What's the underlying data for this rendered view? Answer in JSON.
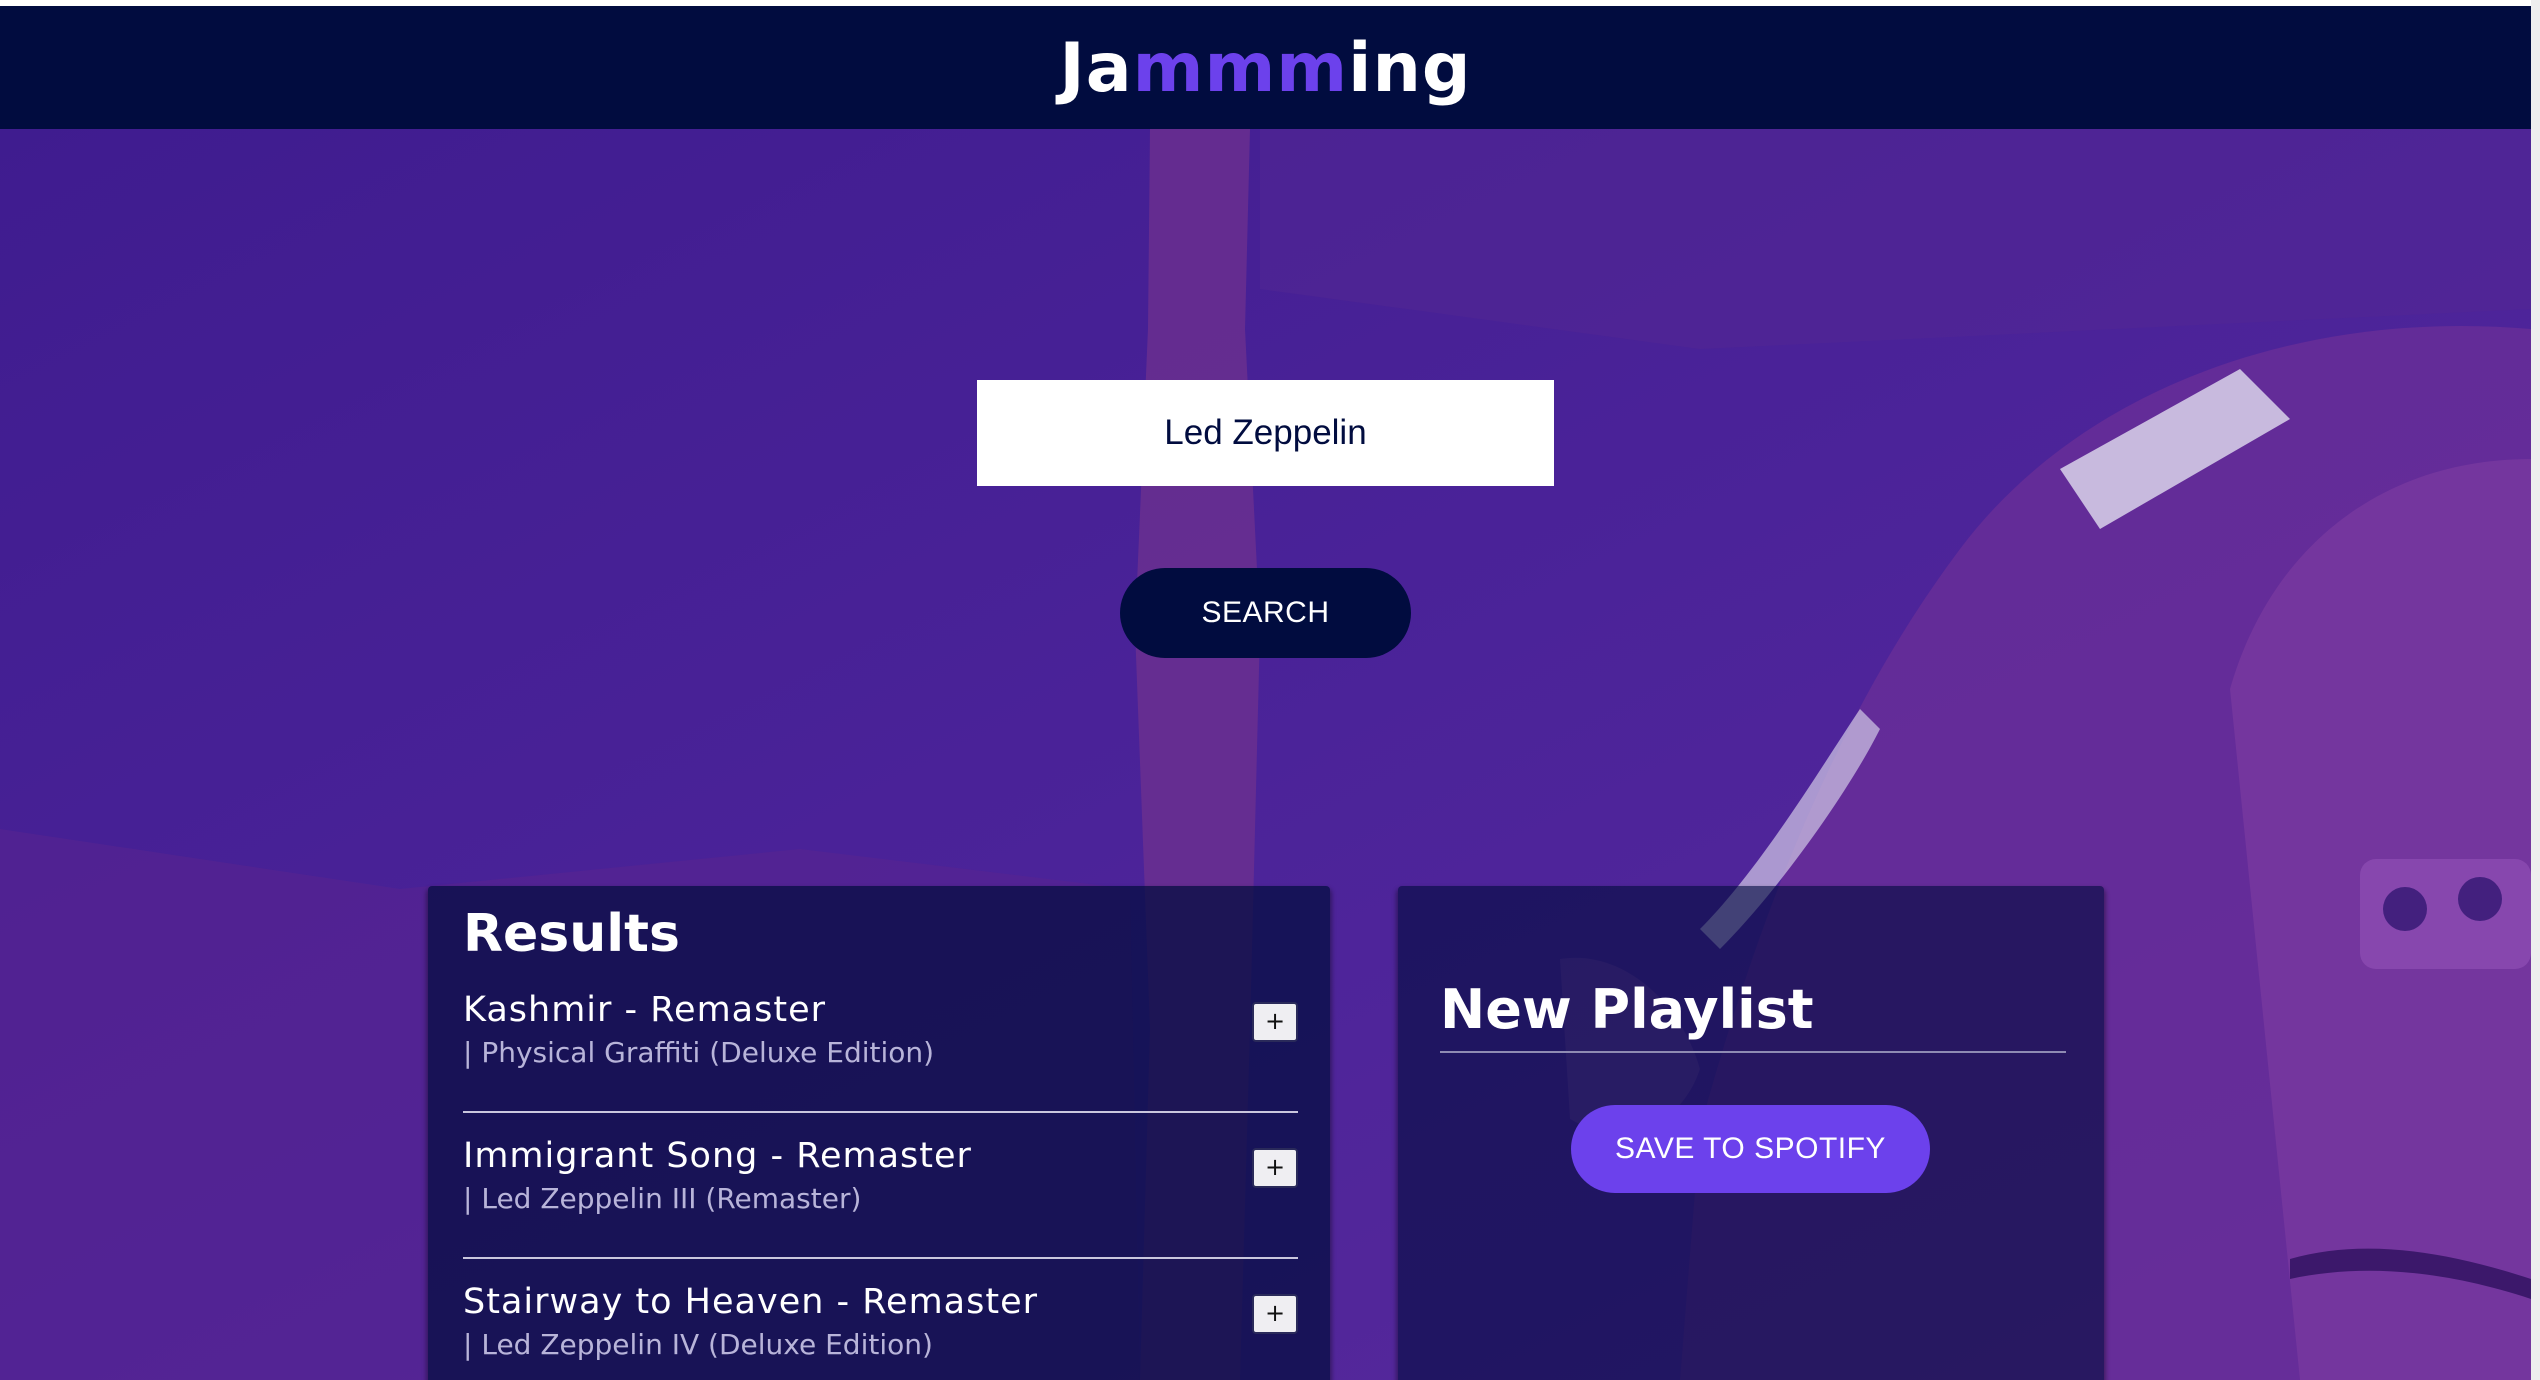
{
  "header": {
    "logo_prefix": "Ja",
    "logo_accent": "mmm",
    "logo_suffix": "ing"
  },
  "search": {
    "value": "Led Zeppelin",
    "button_label": "SEARCH"
  },
  "results": {
    "title": "Results",
    "tracks": [
      {
        "name": "Kashmir - Remaster",
        "album": "| Physical Graffiti (Deluxe Edition)",
        "action": "+"
      },
      {
        "name": "Immigrant Song - Remaster",
        "album": "| Led Zeppelin III (Remaster)",
        "action": "+"
      },
      {
        "name": "Stairway to Heaven - Remaster",
        "album": "| Led Zeppelin IV (Deluxe Edition)",
        "action": "+"
      }
    ]
  },
  "playlist": {
    "title": "New Playlist",
    "save_label": "SAVE TO SPOTIFY"
  },
  "colors": {
    "header_bg": "#010c3f",
    "accent": "#6c41ec",
    "background": "#4a2398",
    "panel_bg": "#010c3f"
  }
}
